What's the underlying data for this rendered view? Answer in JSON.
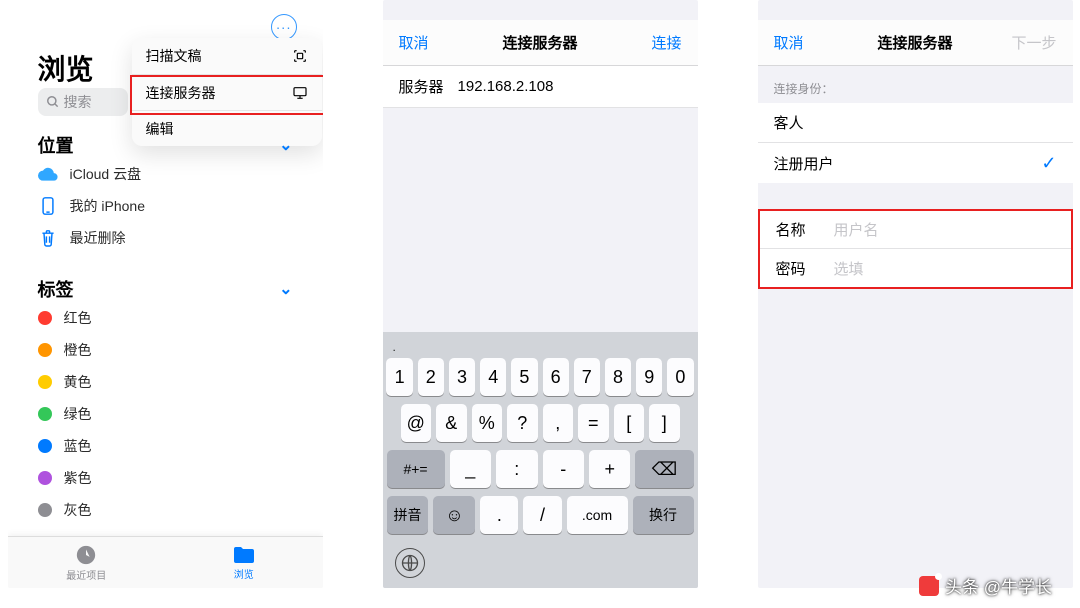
{
  "phone1": {
    "title": "浏览",
    "search_placeholder": "搜索",
    "menu": {
      "scan": "扫描文稿",
      "connect": "连接服务器",
      "edit": "编辑"
    },
    "sections": {
      "locations_title": "位置",
      "icloud": "iCloud 云盘",
      "my_iphone": "我的 iPhone",
      "recently_deleted": "最近删除",
      "tags_title": "标签",
      "tags": [
        {
          "name": "红色",
          "color": "#ff3b30"
        },
        {
          "name": "橙色",
          "color": "#ff9500"
        },
        {
          "name": "黄色",
          "color": "#ffcc00"
        },
        {
          "name": "绿色",
          "color": "#34c759"
        },
        {
          "name": "蓝色",
          "color": "#007aff"
        },
        {
          "name": "紫色",
          "color": "#af52de"
        },
        {
          "name": "灰色",
          "color": "#8e8e93"
        }
      ]
    },
    "tabbar": {
      "recents": "最近项目",
      "browse": "浏览"
    }
  },
  "phone2": {
    "nav": {
      "cancel": "取消",
      "title": "连接服务器",
      "connect": "连接"
    },
    "server_label": "服务器",
    "server_value": "192.168.2.108",
    "kbd": {
      "hint": ".",
      "row1": [
        "1",
        "2",
        "3",
        "4",
        "5",
        "6",
        "7",
        "8",
        "9",
        "0"
      ],
      "row2": [
        "@",
        "&",
        "%",
        "?",
        ",",
        "=",
        "[",
        "]"
      ],
      "alt": "#+=",
      "row3": [
        "_",
        ":",
        "-",
        "+"
      ],
      "backspace": "⌫",
      "pinyin": "拼音",
      "emoji": "☺",
      "dot": ".",
      "slash": "/",
      "com": ".com",
      "enter": "换行"
    }
  },
  "phone3": {
    "nav": {
      "cancel": "取消",
      "title": "连接服务器",
      "next": "下一步"
    },
    "section_label": "连接身份：",
    "guest": "客人",
    "registered": "注册用户",
    "name_label": "名称",
    "name_placeholder": "用户名",
    "password_label": "密码",
    "password_placeholder": "选填"
  },
  "watermark": "头条 @牛学长"
}
